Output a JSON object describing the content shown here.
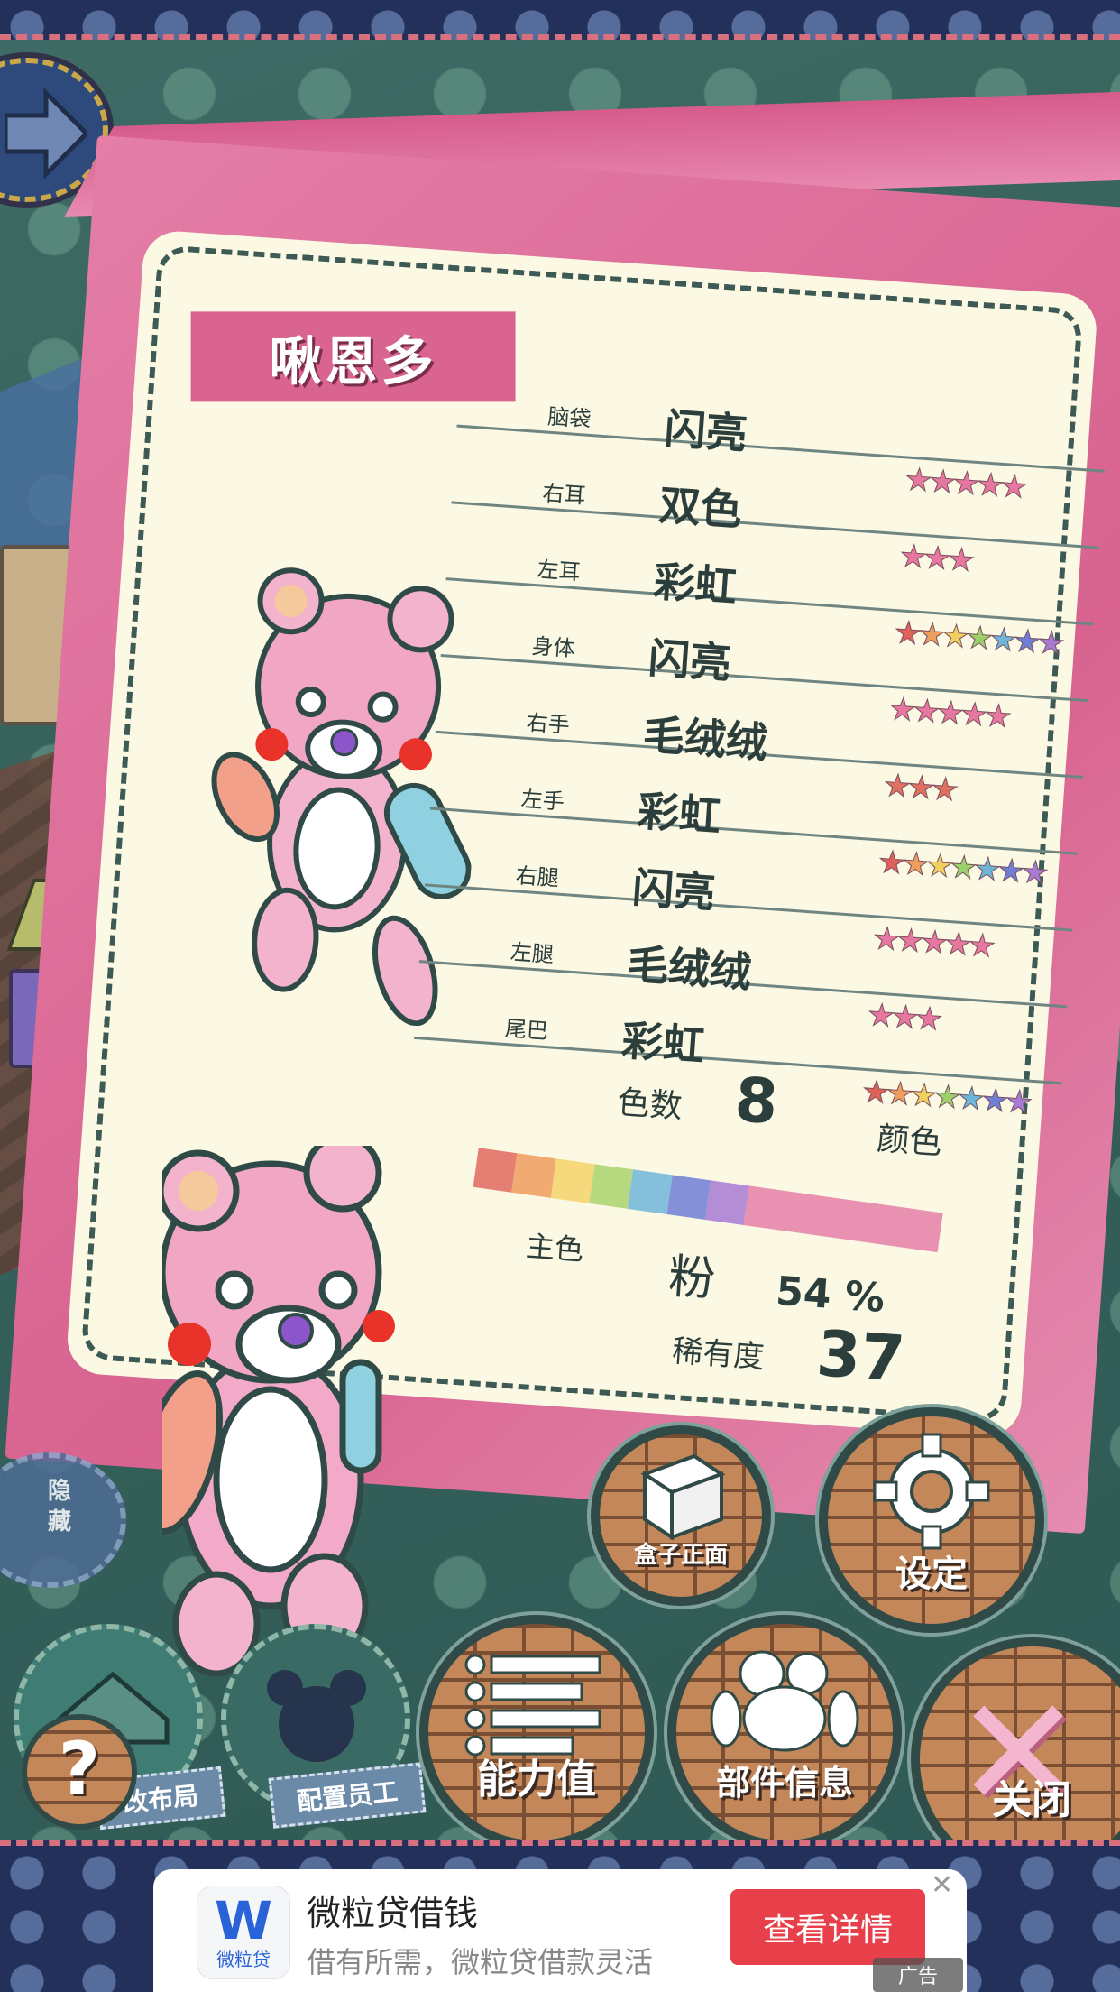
{
  "character": {
    "name": "啾恩多"
  },
  "parts": [
    {
      "part": "脑袋",
      "value": "闪亮",
      "stars": "★★★★★",
      "star_color": "#e6779f"
    },
    {
      "part": "右耳",
      "value": "双色",
      "stars": "★★★",
      "star_color": "#e6779f"
    },
    {
      "part": "左耳",
      "value": "彩虹",
      "stars": "★★★★★★★",
      "star_color": "rainbow"
    },
    {
      "part": "身体",
      "value": "闪亮",
      "stars": "★★★★★",
      "star_color": "#e6779f"
    },
    {
      "part": "右手",
      "value": "毛绒绒",
      "stars": "★★★",
      "star_color": "#e07060"
    },
    {
      "part": "左手",
      "value": "彩虹",
      "stars": "★★★★★★★",
      "star_color": "rainbow"
    },
    {
      "part": "右腿",
      "value": "闪亮",
      "stars": "★★★★★",
      "star_color": "#e6779f"
    },
    {
      "part": "左腿",
      "value": "毛绒绒",
      "stars": "★★★",
      "star_color": "#e6779f"
    },
    {
      "part": "尾巴",
      "value": "彩虹",
      "stars": "★★★★★★★",
      "star_color": "rainbow"
    }
  ],
  "colors": {
    "count_label": "色数",
    "count": "8",
    "unit_label": "颜色",
    "main_label": "主色",
    "main_value": "粉",
    "main_percent": "54 %",
    "bar_colors": [
      "#e06a5f",
      "#ef9e5e",
      "#f5d36a",
      "#a9d36f",
      "#6fb6d9",
      "#6f7fd6",
      "#a77ad4",
      "#e57fa8"
    ]
  },
  "rarity": {
    "label": "稀有度",
    "value": "37"
  },
  "buttons": {
    "box_front": "盒子正面",
    "settings": "设定",
    "stats": "能力值",
    "parts_info": "部件信息",
    "close": "关闭",
    "hide": "隐藏",
    "layout": "改布局",
    "staff": "配置员工",
    "help": "?"
  },
  "ad": {
    "logo_text": "微粒贷",
    "title": "微粒贷借钱",
    "subtitle": "借有所需，微粒贷借款灵活",
    "cta": "查看详情",
    "tag": "广告",
    "close": "✕"
  },
  "palette": {
    "card_pink": "#d8638f",
    "panel_cream": "#fbf8e3",
    "ink": "#2c3e3b",
    "ad_red": "#e8404a"
  }
}
